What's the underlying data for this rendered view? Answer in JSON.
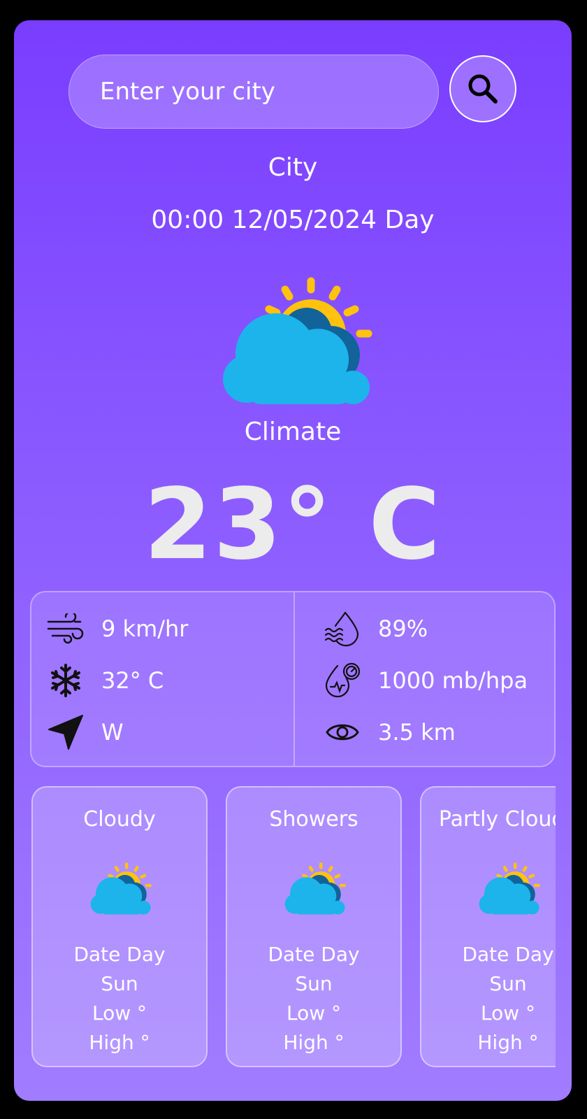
{
  "search": {
    "placeholder": "Enter your city"
  },
  "current": {
    "city": "City",
    "datetime": "00:00 12/05/2024 Day",
    "condition": "Climate",
    "temperature": "23° C"
  },
  "details": {
    "wind_speed": "9 km/hr",
    "feels_like": "32° C",
    "wind_direction": "W",
    "humidity": "89%",
    "pressure": "1000 mb/hpa",
    "visibility": "3.5 km"
  },
  "forecast": [
    {
      "condition": "Cloudy",
      "date": "Date Day",
      "day": "Sun",
      "low": "Low °",
      "high": "High °"
    },
    {
      "condition": "Showers",
      "date": "Date Day",
      "day": "Sun",
      "low": "Low °",
      "high": "High °"
    },
    {
      "condition": "Partly Cloudy",
      "date": "Date Day",
      "day": "Sun",
      "low": "Low °",
      "high": "High °"
    }
  ],
  "colors": {
    "background_top": "#7a3dff",
    "background_bottom": "#a17cff",
    "sun": "#ffc20e",
    "cloud_front": "#1cb4ea",
    "cloud_back": "#11639a"
  },
  "icons": {
    "search": "search-icon",
    "weather": "partly-cloudy-icon",
    "wind": "wind-icon",
    "feels_like": "snowflake-icon",
    "direction": "navigation-arrow-icon",
    "humidity": "humidity-drop-icon",
    "pressure": "pressure-gauge-icon",
    "visibility": "eye-icon"
  }
}
